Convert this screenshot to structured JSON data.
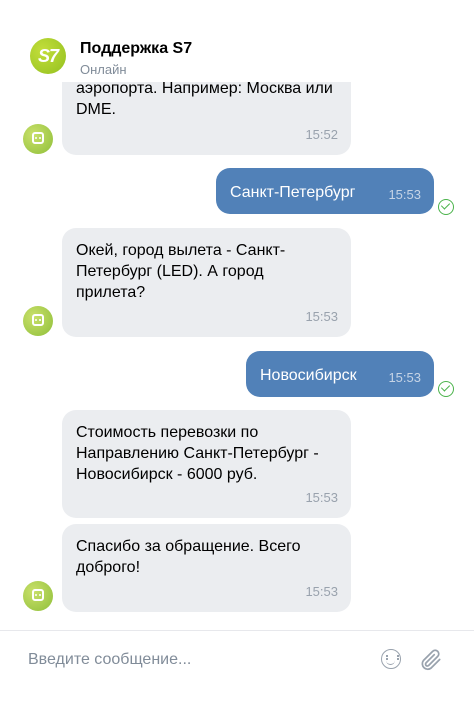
{
  "header": {
    "logo_text": "S7",
    "title": "Поддержка S7",
    "status": "Онлайн"
  },
  "messages": [
    {
      "direction": "in",
      "text": "аэропорта. Например: Москва или DME.",
      "time": "15:52"
    },
    {
      "direction": "out",
      "text": "Санкт-Петербург",
      "time": "15:53",
      "status": "read"
    },
    {
      "direction": "in",
      "text": "Окей, город вылета - Санкт-Петербург (LED). А город прилета?",
      "time": "15:53"
    },
    {
      "direction": "out",
      "text": "Новосибирск",
      "time": "15:53",
      "status": "read"
    },
    {
      "direction": "in",
      "text": "Стоимость перевозки по Направлению Санкт-Петербург - Новосибирск - 6000 руб.",
      "time": "15:53"
    },
    {
      "direction": "in",
      "text": "Спасибо за обращение. Всего доброго!",
      "time": "15:53"
    }
  ],
  "composer": {
    "placeholder": "Введите сообщение...",
    "emoji_icon": "smile-icon",
    "attach_icon": "paperclip-icon"
  },
  "colors": {
    "incoming_bubble": "#ebedf0",
    "outgoing_bubble": "#5181b8",
    "brand": "#a3c72b",
    "read_check": "#4bb34b"
  }
}
